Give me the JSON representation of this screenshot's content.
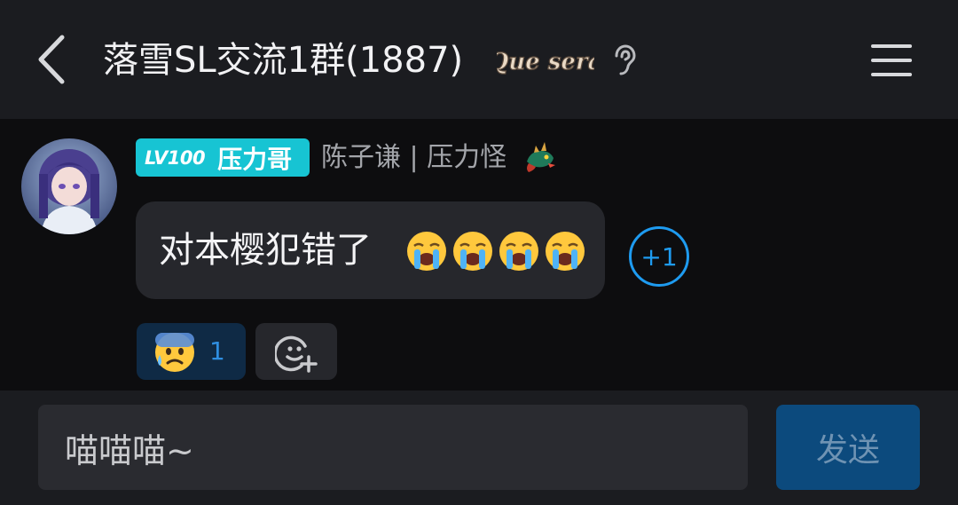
{
  "header": {
    "title": "落雪SL交流1群(1887)",
    "logo_text": "Que sera",
    "back_icon": "chevron-left-icon",
    "ear_icon": "ear-icon",
    "menu_icon": "hamburger-menu-icon"
  },
  "message": {
    "level_label": "LV100",
    "member_title": "压力哥",
    "sender_name": "陈子谦 | 压力怪",
    "text": "对本樱犯错了",
    "emojis": [
      "😭",
      "😭",
      "😭",
      "😭"
    ],
    "plus_one_label": "+1"
  },
  "reactions": [
    {
      "emoji": "😰",
      "count": "1"
    }
  ],
  "input": {
    "value": "喵喵喵~",
    "send_label": "发送"
  },
  "colors": {
    "header_bg": "#1b1c20",
    "chat_bg": "#0d0d0f",
    "bubble_bg": "#26272c",
    "level_tag": "#17c4d3",
    "accent_blue": "#1e9bf0",
    "send_button": "#0c4a7d"
  }
}
